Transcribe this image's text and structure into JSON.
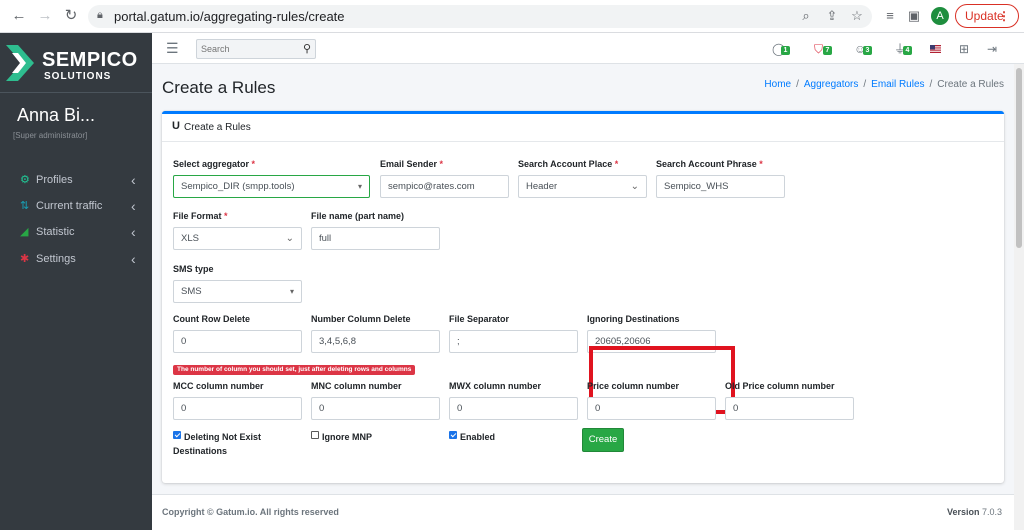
{
  "browser": {
    "url": "portal.gatum.io/aggregating-rules/create",
    "update_label": "Update",
    "avatar_letter": "A"
  },
  "sidebar": {
    "brand": "SEMPICO",
    "brand_sub": "SOLUTIONS",
    "user_name": "Anna Bi...",
    "user_role": "[Super administrator]",
    "items": [
      {
        "label": "Profiles",
        "icon": "profiles-icon"
      },
      {
        "label": "Current traffic",
        "icon": "traffic-icon"
      },
      {
        "label": "Statistic",
        "icon": "chart-icon"
      },
      {
        "label": "Settings",
        "icon": "gears-icon"
      }
    ]
  },
  "topnav": {
    "search_placeholder": "Search",
    "badges": [
      {
        "icon": "comments-icon",
        "count": "1",
        "color": "#28a745"
      },
      {
        "icon": "shield-icon",
        "count": "7",
        "color": "#28a745"
      },
      {
        "icon": "users-icon",
        "count": "3",
        "color": "#28a745"
      },
      {
        "icon": "plugs-icon",
        "count": "4",
        "color": "#28a745"
      }
    ]
  },
  "page": {
    "title": "Create a Rules",
    "breadcrumb": [
      "Home",
      "Aggregators",
      "Email Rules",
      "Create a Rules"
    ],
    "card_title": "Create a Rules"
  },
  "form": {
    "aggregator": {
      "label": "Select aggregator",
      "value": "Sempico_DIR (smpp.tools)"
    },
    "email_sender": {
      "label": "Email Sender",
      "value": "sempico@rates.com"
    },
    "search_place": {
      "label": "Search Account Place",
      "value": "Header"
    },
    "search_phrase": {
      "label": "Search Account Phrase",
      "value": "Sempico_WHS"
    },
    "file_format": {
      "label": "File Format",
      "value": "XLS"
    },
    "file_name": {
      "label": "File name (part name)",
      "value": "full"
    },
    "sms_type": {
      "label": "SMS type",
      "value": "SMS"
    },
    "count_row_delete": {
      "label": "Count Row Delete",
      "value": "0"
    },
    "number_column_delete": {
      "label": "Number Column Delete",
      "value": "3,4,5,6,8"
    },
    "file_separator": {
      "label": "File Separator",
      "value": ";"
    },
    "ignoring_destinations": {
      "label": "Ignoring Destinations",
      "value": "20605,20606"
    },
    "hint": "The number of column you should set, just after deleting rows and columns",
    "mcc": {
      "label": "MCC column number",
      "value": "0"
    },
    "mnc": {
      "label": "MNC column number",
      "value": "0"
    },
    "mwx": {
      "label": "MWX column number",
      "value": "0"
    },
    "price": {
      "label": "Price column number",
      "value": "0"
    },
    "old_price": {
      "label": "Old Price column number",
      "value": "0"
    },
    "deleting_not_exist": {
      "label": "Deleting Not Exist",
      "label2": "Destinations",
      "checked": true
    },
    "ignore_mnp": {
      "label": "Ignore MNP",
      "checked": false
    },
    "enabled": {
      "label": "Enabled",
      "checked": true
    },
    "create_label": "Create",
    "required_mark": "*"
  },
  "footer": {
    "copyright": "Copyright © Gatum.io. All rights reserved",
    "version_label": "Version",
    "version": "7.0.3"
  }
}
